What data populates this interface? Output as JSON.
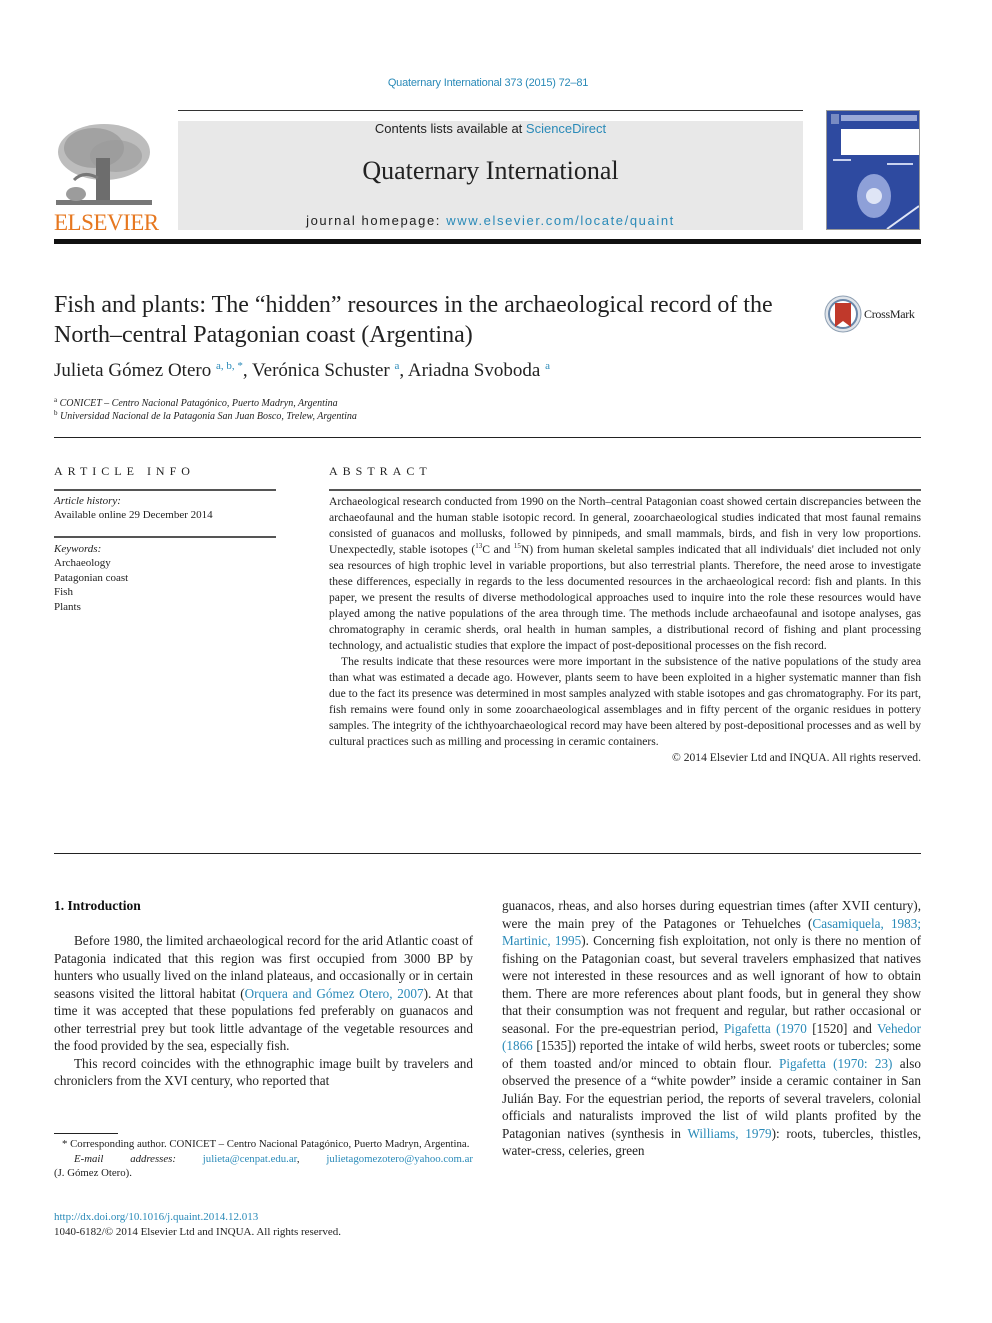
{
  "header": {
    "citation": "Quaternary International 373 (2015) 72–81",
    "contents_prefix": "Contents lists available at ",
    "contents_link": "ScienceDirect",
    "journal_title": "Quaternary International",
    "homepage_prefix": "journal homepage: ",
    "homepage_link": "www.elsevier.com/locate/quaint",
    "publisher_logo_text": "ELSEVIER",
    "brand_color": "#e6771f",
    "link_color": "#2a8ab8"
  },
  "article": {
    "title": "Fish and plants: The “hidden” resources in the archaeological record of the North–central Patagonian coast (Argentina)",
    "crossmark_label": "CrossMark",
    "authors": [
      {
        "name": "Julieta Gómez Otero",
        "sup": "a, b, *"
      },
      {
        "name": "Verónica Schuster",
        "sup": "a"
      },
      {
        "name": "Ariadna Svoboda",
        "sup": "a"
      }
    ],
    "affiliations": [
      {
        "key": "a",
        "text": "CONICET – Centro Nacional Patagónico, Puerto Madryn, Argentina"
      },
      {
        "key": "b",
        "text": "Universidad Nacional de la Patagonia San Juan Bosco, Trelew, Argentina"
      }
    ]
  },
  "article_info": {
    "heading": "ARTICLE INFO",
    "history_label": "Article history:",
    "history_value": "Available online 29 December 2014",
    "keywords_label": "Keywords:",
    "keywords": [
      "Archaeology",
      "Patagonian coast",
      "Fish",
      "Plants"
    ]
  },
  "abstract": {
    "heading": "ABSTRACT",
    "p1_a": "Archaeological research conducted from 1990 on the North–central Patagonian coast showed certain discrepancies between the archaeofaunal and the human stable isotopic record. In general, zooarch­aeological studies indicated that most faunal remains consisted of guanacos and mollusks, followed by pinnipeds, and small mammals, birds, and fish in very low proportions. Unexpectedly, stable isotopes (",
    "iso1": "13",
    "p1_b": "C and ",
    "iso2": "15",
    "p1_c": "N) from human skeletal samples indicated that all individuals' diet included not only sea resources of high trophic level in variable proportions, but also terrestrial plants. Therefore, the need arose to investigate these differences, especially in regards to the less documented resources in the archaeological record: fish and plants. In this paper, we present the results of diverse methodological approaches used to inquire into the role these resources would have played among the native pop­ulations of the area through time. The methods include archaeofaunal and isotope analyses, gas chro­matography in ceramic sherds, oral health in human samples, a distributional record of fishing and plant processing technology, and actualistic studies that explore the impact of post-depositional processes on the fish record.",
    "p2": "The results indicate that these resources were more important in the subsistence of the native pop­ulations of the study area than what was estimated a decade ago. However, plants seem to have been exploited in a higher systematic manner than fish due to the fact its presence was determined in most samples analyzed with stable isotopes and gas chromatography. For its part, fish remains were found only in some zooarchaeological assemblages and in fifty percent of the organic residues in pottery samples. The integrity of the ichthyoarchaeological record may have been altered by post-depositional processes and as well by cultural practices such as milling and processing in ceramic containers.",
    "copyright": "© 2014 Elsevier Ltd and INQUA. All rights reserved."
  },
  "body": {
    "section_title": "1.  Introduction",
    "left_p1_a": "Before 1980, the limited archaeological record for the arid Atlantic coast of Patagonia indicated that this region was first occupied from 3000 BP by hunters who usually lived on the inland plateaus, and occasionally or in certain seasons visited the littoral habitat (",
    "left_p1_ref": "Orquera and Gómez Otero, 2007",
    "left_p1_b": "). At that time it was accepted that these populations fed preferably on guanacos and other terrestrial prey but took little advantage of the vegetable resources and the food provided by the sea, especially fish.",
    "left_p2": "This record coincides with the ethnographic image built by travelers and chroniclers from the XVI century, who reported that",
    "right_a": "guanacos, rheas, and also horses during equestrian times (after XVII century), were the main prey of the Patagones or Tehuelches (",
    "right_ref1": "Casamiquela, 1983; Martinic, 1995",
    "right_b": "). Concerning fish exploitation, not only is there no mention of fishing on the Patagonian coast, but several travelers emphasized that natives were not interested in these resources and as well ignorant of how to obtain them. There are more references about plant foods, but in general they show that their consumption was not frequent and regular, but rather occasional or seasonal. For the pre-equestrian period, ",
    "right_ref2": "Pigafetta (1970",
    "right_c": " [1520] and ",
    "right_ref3": "Vehedor (1866",
    "right_d": " [1535]) reported the intake of wild herbs, sweet roots or tubercles; some of them toasted and/or minced to obtain flour. ",
    "right_ref4": "Pigafetta (1970: 23)",
    "right_e": " also observed the presence of a “white powder” inside a ceramic container in San Julián Bay. For the equestrian period, the reports of several trav­elers, colonial officials and naturalists improved the list of wild plants profited by the Patagonian natives (synthesis in ",
    "right_ref5": "Williams, 1979",
    "right_f": "): roots, tubercles, thistles, water-cress, celeries, green"
  },
  "footnotes": {
    "corresponding": "* Corresponding author. CONICET – Centro Nacional Patagónico, Puerto Madryn, Argentina.",
    "email_label": "E-mail addresses:",
    "email1": "julieta@cenpat.edu.ar",
    "email2": "julietagomezotero@yahoo.com.ar",
    "email_owner": "(J. Gómez Otero).",
    "doi": "http://dx.doi.org/10.1016/j.quaint.2014.12.013",
    "issn": "1040-6182/© 2014 Elsevier Ltd and INQUA. All rights reserved."
  }
}
